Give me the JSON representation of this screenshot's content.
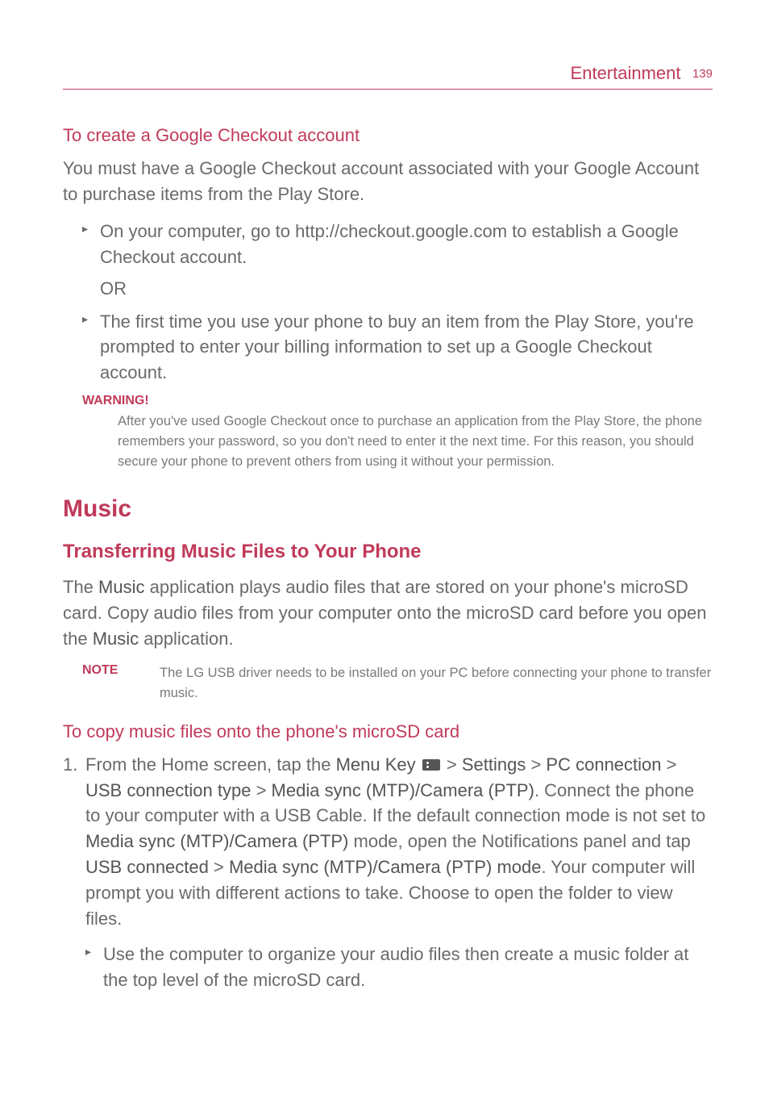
{
  "header": {
    "section": "Entertainment",
    "page_number": "139"
  },
  "s1": {
    "heading": "To create a Google Checkout account",
    "intro": "You must have a Google Checkout account associated with your Google Account to purchase items from the Play Store.",
    "bullet1": "On your computer, go to http://checkout.google.com to establish a Google Checkout account.",
    "or": "OR",
    "bullet2": "The first time you use your phone to buy an item from the Play Store, you're prompted to enter your billing information to set up a Google Checkout account."
  },
  "warning": {
    "label": "WARNING!",
    "text": "After you've used Google Checkout once to purchase an application from the Play Store, the phone remembers your password, so you don't need to enter it the next time. For this reason, you should secure your phone to prevent others from using it without your permission."
  },
  "music": {
    "h1": "Music",
    "h2": "Transferring Music Files to Your Phone",
    "para_pre": "The ",
    "para_music1": "Music",
    "para_mid": " application plays audio files that are stored on your phone's microSD card. Copy audio files from your computer onto the microSD card before you open the ",
    "para_music2": "Music",
    "para_post": " application."
  },
  "note": {
    "label": "NOTE",
    "text": "The LG USB driver needs to be installed on your PC before connecting your phone to transfer music."
  },
  "s2": {
    "heading": "To copy music files onto the phone's microSD card",
    "marker": "1.",
    "p": {
      "t1": "From the Home screen, tap the ",
      "b1": "Menu Key",
      "t2": " > ",
      "b2": "Settings",
      "t3": " > ",
      "b3": "PC connection",
      "t4": " > ",
      "b4": "USB connection type",
      "t5": " > ",
      "b5": "Media sync (MTP)/Camera (PTP)",
      "t6": ". Connect the phone to your computer with a USB Cable. If the default connection mode is not set to ",
      "b6": "Media sync (MTP)/Camera (PTP)",
      "t7": " mode, open the Notifications panel and tap ",
      "b7": "USB connected",
      "t8": " > ",
      "b8": "Media sync (MTP)/Camera (PTP) mode",
      "t9": ". Your computer will prompt you with different actions to take. Choose to open the folder to view files."
    },
    "sub_bullet": "Use the computer to organize your audio files then create a music folder at the top level of the microSD card."
  }
}
